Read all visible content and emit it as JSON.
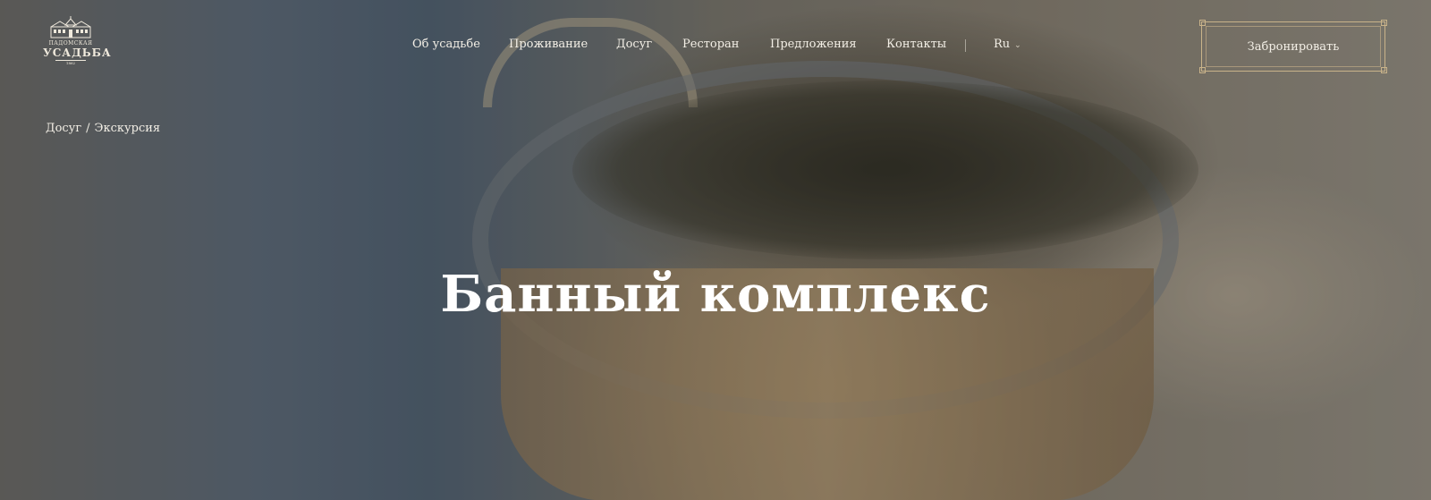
{
  "logo": {
    "top_text": "ПАДОМСКАЯ",
    "main_text": "УСАДЬБА",
    "year": "1862"
  },
  "nav": {
    "items": [
      {
        "label": "Об усадьбе"
      },
      {
        "label": "Проживание"
      },
      {
        "label": "Досуг"
      },
      {
        "label": "Ресторан"
      },
      {
        "label": "Предложения"
      },
      {
        "label": "Контакты"
      }
    ],
    "language": "Ru"
  },
  "book_button": "Забронировать",
  "breadcrumb": {
    "items": [
      {
        "label": "Досуг"
      },
      {
        "label": "Экскурсия"
      }
    ],
    "separator": "/"
  },
  "hero": {
    "title": "Банный комплекс"
  },
  "colors": {
    "accent_gold": "#c9b38a",
    "text_light": "#f3efe6"
  }
}
